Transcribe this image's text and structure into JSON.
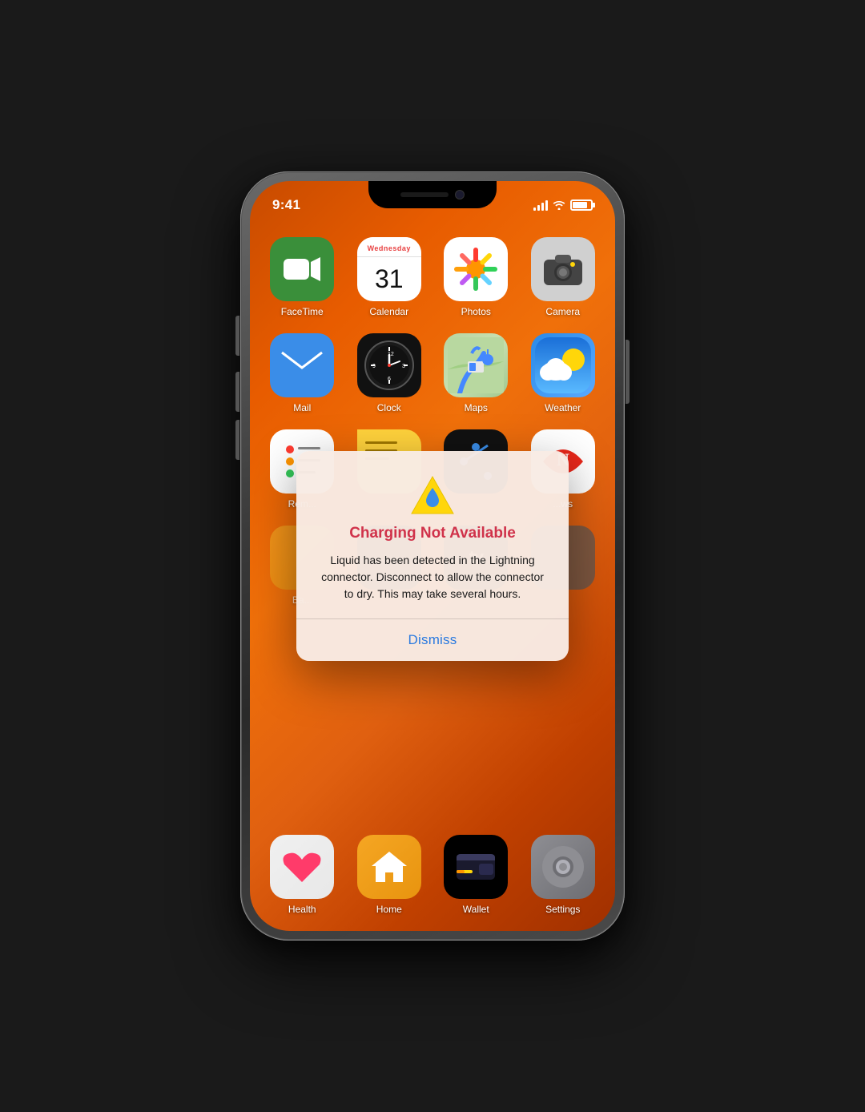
{
  "phone": {
    "status_bar": {
      "time": "9:41",
      "signal_label": "signal",
      "wifi_label": "wifi",
      "battery_label": "battery"
    },
    "apps_row1": [
      {
        "id": "facetime",
        "label": "FaceTime",
        "icon_type": "facetime"
      },
      {
        "id": "calendar",
        "label": "Calendar",
        "icon_type": "calendar",
        "day_of_week": "Wednesday",
        "day": "31"
      },
      {
        "id": "photos",
        "label": "Photos",
        "icon_type": "photos"
      },
      {
        "id": "camera",
        "label": "Camera",
        "icon_type": "camera"
      }
    ],
    "apps_row2": [
      {
        "id": "mail",
        "label": "Mail",
        "icon_type": "mail"
      },
      {
        "id": "clock",
        "label": "Clock",
        "icon_type": "clock"
      },
      {
        "id": "maps",
        "label": "Maps",
        "icon_type": "maps"
      },
      {
        "id": "weather",
        "label": "Weather",
        "icon_type": "weather"
      }
    ],
    "apps_row3": [
      {
        "id": "reminders",
        "label": "Rem...",
        "icon_type": "reminders"
      },
      {
        "id": "notes",
        "label": "",
        "icon_type": "notes"
      },
      {
        "id": "app3",
        "label": "",
        "icon_type": "dark"
      },
      {
        "id": "news",
        "label": "...ws",
        "icon_type": "news"
      }
    ],
    "apps_row4": [
      {
        "id": "app4a",
        "label": "Ba...",
        "icon_type": "orange"
      },
      {
        "id": "app4b",
        "label": "",
        "icon_type": "dark2"
      },
      {
        "id": "appletv",
        "label": "",
        "icon_type": "dark3"
      },
      {
        "id": "app4d",
        "label": "",
        "icon_type": "dark4"
      }
    ],
    "dock": [
      {
        "id": "health",
        "label": "Health",
        "icon_type": "health"
      },
      {
        "id": "home",
        "label": "Home",
        "icon_type": "home"
      },
      {
        "id": "wallet",
        "label": "Wallet",
        "icon_type": "wallet"
      },
      {
        "id": "settings",
        "label": "Settings",
        "icon_type": "settings"
      }
    ]
  },
  "alert": {
    "icon": "⚠️💧",
    "title": "Charging Not Available",
    "message": "Liquid has been detected in the Lightning connector. Disconnect to allow the connector to dry. This may take several hours.",
    "dismiss_label": "Dismiss"
  }
}
